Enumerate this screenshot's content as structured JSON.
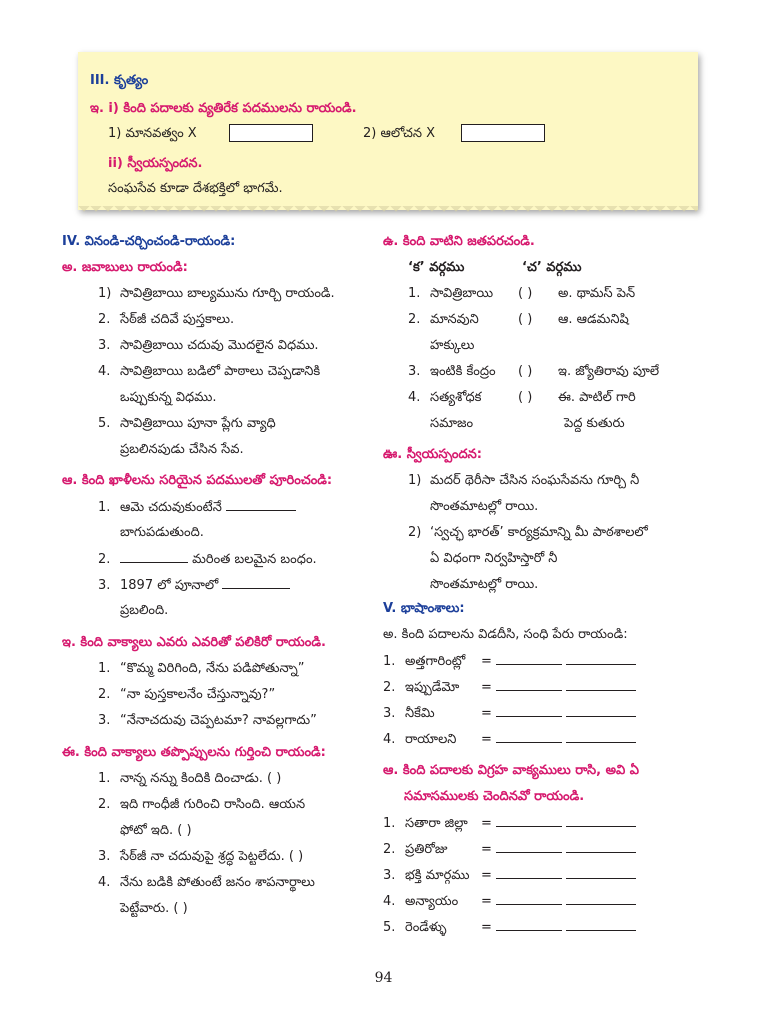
{
  "box": {
    "heading": "III. కృత్యం",
    "q1": "ఇ. i) కింది పదాలకు వ్యతిరేక పదములను రాయండి.",
    "q1_items": [
      "1)  మానవత్వం X",
      "2) ఆలోచన X"
    ],
    "q2": "ii) స్వీయస్పందన.",
    "q2_text": "సంఘసేవ కూడా దేశభక్తిలో భాగమే."
  },
  "left": {
    "sec4": "IV. వినండి-చర్చించండి-రాయండి:",
    "a_head": "అ. జవాబులు రాయండి:",
    "a_items": [
      [
        "1)",
        "సావిత్రిబాయి బాల్యమును గూర్చి రాయండి."
      ],
      [
        "2.",
        "సేఠ్‌జీ చదివే పుస్తకాలు."
      ],
      [
        "3.",
        "సావిత్రిబాయి చదువు మొదలైన విధము."
      ],
      [
        "4.",
        "సావిత్రిబాయి బడిలో పాఠాలు చెప్పడానికి"
      ],
      [
        "",
        "ఒప్పుకున్న విధము."
      ],
      [
        "5.",
        "సావిత్రిబాయి పూనా ప్లేగు వ్యాధి"
      ],
      [
        "",
        "ప్రబలినపుడు చేసిన సేవ."
      ]
    ],
    "aa_head": "ఆ. కింది ఖాళీలను సరియైన పదములతో పూరించండి:",
    "aa_items": [
      [
        "1.",
        "ఆమె చదువుకుంటేనే"
      ],
      [
        "",
        "బాగుపడుతుంది."
      ],
      [
        "2.",
        "మరింత బలమైన బంధం."
      ],
      [
        "3.",
        "1897 లో పూనాలో"
      ],
      [
        "",
        "ప్రబలింది."
      ]
    ],
    "i_head": "ఇ. కింది వాక్యాలు ఎవరు ఎవరితో పలికిరో రాయండి.",
    "i_items": [
      [
        "1.",
        "“కొమ్మ విరిగింది, నేను పడిపోతున్నా”"
      ],
      [
        "2.",
        "“నా పుస్తకాలనేం చేస్తున్నావు?”"
      ],
      [
        "3.",
        "“నేనాచదువు చెప్పటమా? నావల్లగాదు”"
      ]
    ],
    "ii_head": "ఈ. కింది వాక్యాలు తప్పొప్పులను గుర్తించి రాయండి:",
    "ii_items": [
      [
        "1.",
        "నాన్న నన్ను కిందికి దించాడు. (   )"
      ],
      [
        "2.",
        "ఇది గాంధీజీ గురించి రాసింది. ఆయన"
      ],
      [
        "",
        "ఫోటో ఇది. (   )"
      ],
      [
        "3.",
        "సేఠ్‌జీ నా చదువుపై శ్రద్ధ పెట్టలేదు. (   )"
      ],
      [
        "4.",
        "నేను బడికి పోతుంటే జనం శాపనార్థాలు"
      ],
      [
        "",
        "పెట్టేవారు. (   )"
      ]
    ]
  },
  "right": {
    "u_head": "ఉ. కింది వాటిని జతపరచండి.",
    "col_ka": "‘క’ వర్గము",
    "col_cha": "‘చ’ వర్గము",
    "match": [
      [
        "1.",
        "సావిత్రిబాయి",
        "(   )",
        "అ. థామస్ పెన్"
      ],
      [
        "2.",
        "మానవుని",
        "(   )",
        "ఆ. ఆడమనిషి"
      ],
      [
        "",
        "హక్కులు",
        "",
        ""
      ],
      [
        "3.",
        "ఇంటికి కేంద్రం",
        "(   )",
        "ఇ. జ్యోతిరావు పూలే"
      ],
      [
        "4.",
        "సత్యశోధక",
        "(   )",
        "ఈ. పాటిల్ గారి"
      ],
      [
        "",
        "సమాజం",
        "",
        "పెద్ద కుతురు"
      ]
    ],
    "uu_head": "ఊ. స్వీయస్పందన:",
    "uu_items": [
      [
        "1)",
        "మదర్ థెరీసా చేసిన సంఘసేవను గూర్చి నీ"
      ],
      [
        "",
        "సొంతమాటల్లో రాయి."
      ],
      [
        "2)",
        "‘స్వచ్ఛ భారత్’ కార్యక్రమాన్ని మీ పాఠశాలలో"
      ],
      [
        "",
        "ఏ విధంగా నిర్వహిస్తారో నీ"
      ],
      [
        "",
        "సొంతమాటల్లో రాయి."
      ]
    ],
    "sec5": "V. భాషాంశాలు:",
    "v_a": "అ. కింది పదాలను విడదీసి, సంధి పేరు రాయండి:",
    "v_a_items": [
      [
        "1.",
        "అత్తగారింట్లో",
        "="
      ],
      [
        "2.",
        "ఇప్పుడేమో",
        "="
      ],
      [
        "3.",
        "నీకేమి",
        "="
      ],
      [
        "4.",
        "రాయాలని",
        "="
      ]
    ],
    "v_aa": [
      "ఆ. కింది పదాలకు విగ్రహ వాక్యములు రాసి, అవి ఏ",
      "సమాసములకు చెందినవో రాయండి."
    ],
    "v_aa_items": [
      [
        "1.",
        "సతారా జిల్లా",
        "="
      ],
      [
        "2.",
        "ప్రతిరోజు",
        "="
      ],
      [
        "3.",
        "భక్తి మార్గము",
        "="
      ],
      [
        "4.",
        "అన్యాయం",
        "="
      ],
      [
        "5.",
        "రెండేళ్ళు",
        "="
      ]
    ]
  },
  "page_number": "94"
}
